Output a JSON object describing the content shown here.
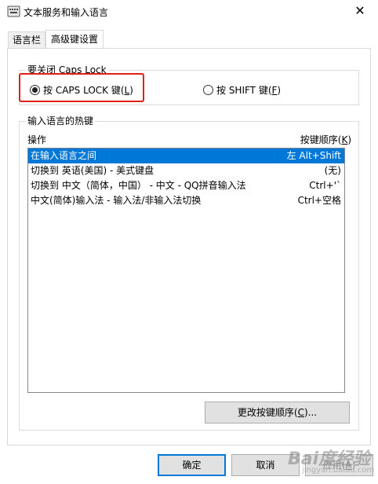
{
  "window": {
    "title": "文本服务和输入语言",
    "close_glyph": "✕"
  },
  "tabs": [
    {
      "label": "语言栏"
    },
    {
      "label": "高级键设置"
    }
  ],
  "caps_group": {
    "title": "要关闭 Caps Lock",
    "option_caps": {
      "text": "按 CAPS LOCK 键(",
      "access": "L",
      "end": ")"
    },
    "option_shift": {
      "text": "按 SHIFT 键(",
      "access": "F",
      "end": ")"
    },
    "selected": "caps"
  },
  "hotkey_group": {
    "title": "输入语言的热键",
    "col_action": "操作",
    "col_keys": {
      "text": "按键顺序(",
      "access": "K",
      "end": ")"
    },
    "rows": [
      {
        "action": "在输入语言之间",
        "keys": "左 Alt+Shift",
        "selected": true
      },
      {
        "action": "切换到 英语(美国) - 美式键盘",
        "keys": "(无)"
      },
      {
        "action": "切换到 中文（简体，中国） - 中文 - QQ拼音输入法",
        "keys": "Ctrl+'`"
      },
      {
        "action": "中文(简体)输入法 - 输入法/非输入法切换",
        "keys": "Ctrl+空格"
      }
    ],
    "change_button": {
      "text": "更改按键顺序(",
      "access": "C",
      "end": ")..."
    }
  },
  "footer": {
    "ok": "确定",
    "cancel": "取消",
    "apply": {
      "text": "应用(",
      "access": "A",
      "end": ")"
    }
  },
  "watermark": {
    "text": "Bai度经验",
    "sub": "jingyan.baidu.com"
  },
  "colors": {
    "selection": "#0078d7",
    "highlight_box": "#e32018"
  }
}
